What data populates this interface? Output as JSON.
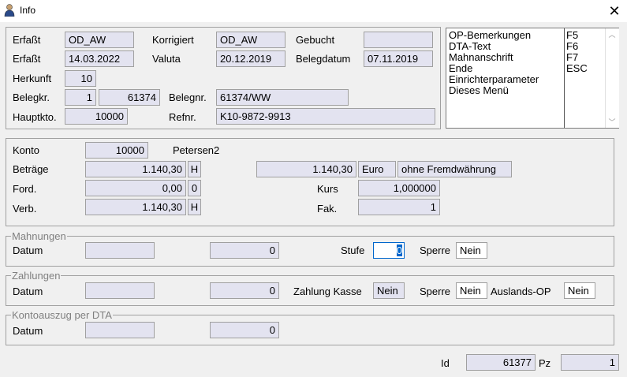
{
  "window": {
    "title": "Info",
    "close_symbol": "✕"
  },
  "header": {
    "erfasst_label": "Erfaßt",
    "erfasst_by": "OD_AW",
    "korrigiert_label": "Korrigiert",
    "korrigiert_by": "OD_AW",
    "gebucht_label": "Gebucht",
    "gebucht_value": "",
    "erfasst_date_label": "Erfaßt",
    "erfasst_date": "14.03.2022",
    "valuta_label": "Valuta",
    "valuta_date": "20.12.2019",
    "belegdatum_label": "Belegdatum",
    "belegdatum": "07.11.2019",
    "herkunft_label": "Herkunft",
    "herkunft": "10",
    "belegkr_label": "Belegkr.",
    "belegkr_1": "1",
    "belegkr_2": "61374",
    "belegnr_label": "Belegnr.",
    "belegnr": "61374/WW",
    "hauptkto_label": "Hauptkto.",
    "hauptkto": "10000",
    "refnr_label": "Refnr.",
    "refnr": "K10-9872-9913"
  },
  "shortcuts": [
    {
      "label": "OP-Bemerkungen",
      "key": "F5"
    },
    {
      "label": "DTA-Text",
      "key": "F6"
    },
    {
      "label": "Mahnanschrift",
      "key": "F7"
    },
    {
      "label": "Ende",
      "key": "ESC"
    },
    {
      "label": "Einrichterparameter",
      "key": ""
    },
    {
      "label": "Dieses Menü",
      "key": ""
    }
  ],
  "account": {
    "konto_label": "Konto",
    "konto": "10000",
    "konto_name": "Petersen2",
    "betraege_label": "Beträge",
    "betraege": "1.140,30",
    "betraege_sh": "H",
    "fw_betrag": "1.140,30",
    "currency": "Euro",
    "fremdwaehrung": "ohne Fremdwährung",
    "ford_label": "Ford.",
    "ford": "0,00",
    "ford_sh": "0",
    "kurs_label": "Kurs",
    "kurs": "1,000000",
    "verb_label": "Verb.",
    "verb": "1.140,30",
    "verb_sh": "H",
    "fak_label": "Fak.",
    "fak": "1"
  },
  "mahnungen": {
    "legend": "Mahnungen",
    "datum_label": "Datum",
    "datum": "",
    "value": "0",
    "stufe_label": "Stufe",
    "stufe": "0",
    "sperre_label": "Sperre",
    "sperre": "Nein"
  },
  "zahlungen": {
    "legend": "Zahlungen",
    "datum_label": "Datum",
    "datum": "",
    "value": "0",
    "kasse_label": "Zahlung Kasse",
    "kasse": "Nein",
    "sperre_label": "Sperre",
    "sperre": "Nein",
    "auslands_label": "Auslands-OP",
    "auslands": "Nein"
  },
  "kontoauszug": {
    "legend": "Kontoauszug per DTA",
    "datum_label": "Datum",
    "datum": "",
    "value": "0"
  },
  "footer": {
    "id_label": "Id",
    "id": "61377",
    "pz_label": "Pz",
    "pz": "1"
  }
}
